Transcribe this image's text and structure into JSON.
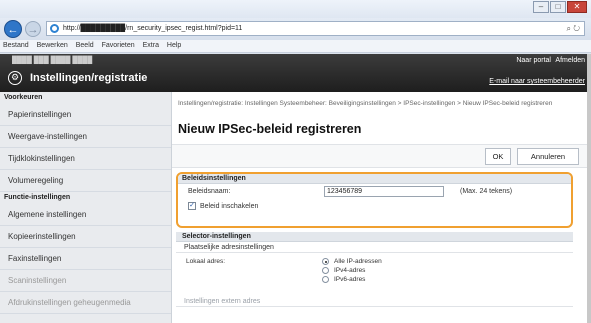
{
  "browser": {
    "url": "http://█████████/rn_security_ipsec_regist.html?pid=11",
    "menu": [
      "Bestand",
      "Bewerken",
      "Beeld",
      "Favorieten",
      "Extra",
      "Help"
    ],
    "window_buttons": [
      "–",
      "□",
      "✕"
    ]
  },
  "app": {
    "device_info": "████  ███  ████  ████",
    "portal": "Naar portal",
    "logout": "Afmelden",
    "title": "Instellingen/registratie",
    "email_link": "E-mail naar systeembeheerder"
  },
  "sidebar": {
    "section1": "Voorkeuren",
    "items1": [
      "Papierinstellingen",
      "Weergave-instellingen",
      "Tijdklokinstellingen",
      "Volumeregeling"
    ],
    "section2": "Functie-instellingen",
    "items2": [
      "Algemene instellingen",
      "Kopieerinstellingen",
      "Faxinstellingen",
      "Scaninstellingen",
      "Afdrukinstellingen geheugenmedia"
    ]
  },
  "main": {
    "breadcrumb": "Instellingen/registratie: Instellingen Systeembeheer: Beveiligingsinstellingen > IPSec-instellingen > Nieuw IPSec-beleid registreren",
    "page_title": "Nieuw IPSec-beleid registreren",
    "ok_label": "OK",
    "cancel_label": "Annuleren",
    "policy": {
      "heading": "Beleidsinstellingen",
      "name_label": "Beleidsnaam:",
      "name_value": "123456789",
      "name_hint": "(Max. 24 tekens)",
      "enable_label": "Beleid inschakelen",
      "enable_checked": "✓"
    },
    "selector": {
      "heading": "Selector-instellingen",
      "local_subheading": "Plaatselijke adresinstellingen",
      "local_label": "Lokaal adres:",
      "options": [
        "Alle IP-adressen",
        "IPv4-adres",
        "IPv6-adres"
      ],
      "selected_option": "Alle IP-adressen",
      "remote_subheading": "Instellingen extern adres"
    }
  }
}
